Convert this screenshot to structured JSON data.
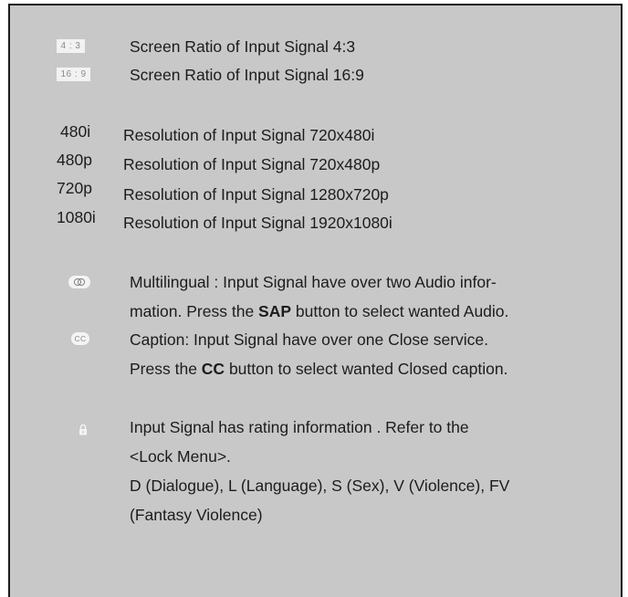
{
  "ratio": {
    "items": [
      {
        "badge": "4 : 3",
        "text": "Screen Ratio of Input Signal 4:3"
      },
      {
        "badge": "16 : 9",
        "text": "Screen Ratio of Input Signal 16:9"
      }
    ]
  },
  "resolution": {
    "items": [
      {
        "label": "480i",
        "text": "Resolution of Input Signal 720x480i"
      },
      {
        "label": "480p",
        "text": "Resolution of Input Signal 720x480p"
      },
      {
        "label": "720p",
        "text": "Resolution of Input Signal 1280x720p"
      },
      {
        "label": "1080i",
        "text": "Resolution of Input Signal 1920x1080i"
      }
    ]
  },
  "multilingual": {
    "icon": "multilingual-audio-icon",
    "line1": "Multilingual : Input Signal have over two Audio infor-",
    "line2_pre": "mation. Press the ",
    "line2_bold": "SAP",
    "line2_post": " button to select wanted Audio."
  },
  "caption": {
    "icon": "closed-caption-icon",
    "icon_text": "CC",
    "line1": "Caption: Input Signal have over one Close service.",
    "line2_pre": "Press the ",
    "line2_bold": "CC",
    "line2_post": " button to select wanted Closed caption."
  },
  "rating": {
    "icon": "lock-icon",
    "line1": "Input Signal has rating information . Refer to the",
    "line2": "<Lock Menu>.",
    "line3": "D (Dialogue), L (Language), S (Sex), V (Violence), FV",
    "line4": "(Fantasy Violence)"
  },
  "colors": {
    "panel_background": "#c8c8c8",
    "border": "#1a1a1a",
    "icon_fill": "#f2f2f2"
  }
}
